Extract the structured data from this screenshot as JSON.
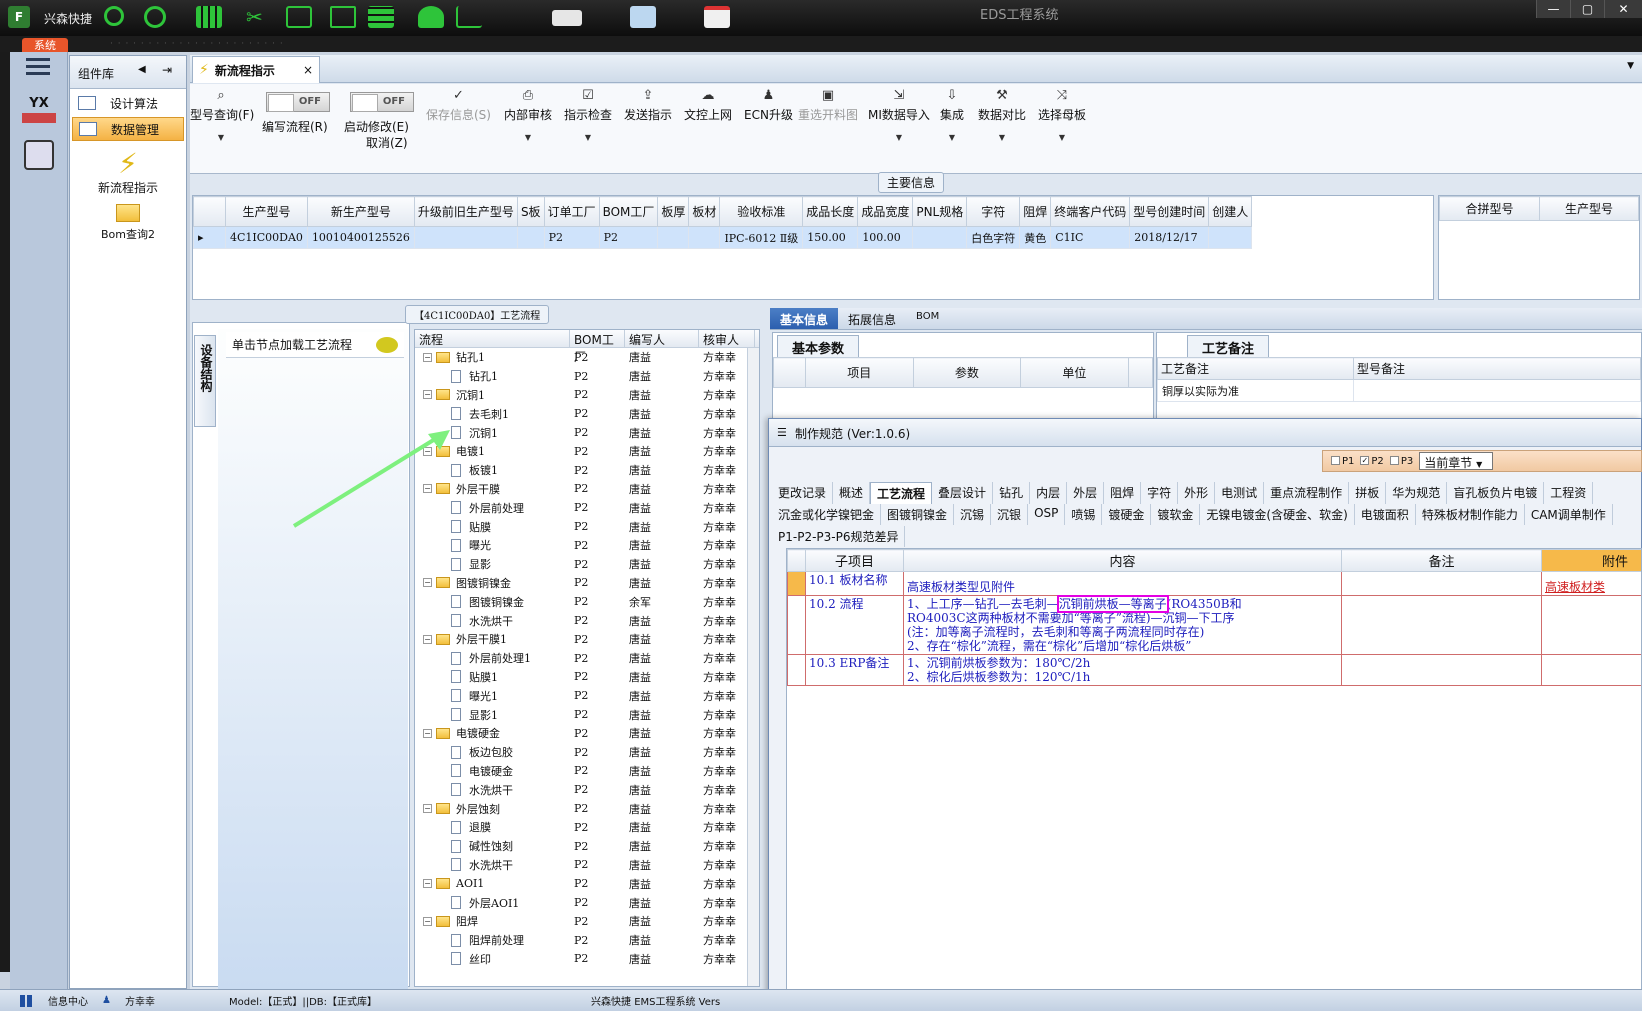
{
  "titlebar": {
    "app_name": "兴森快捷",
    "window_title": "EDS工程系统",
    "btn_min": "—",
    "btn_max": "▢",
    "btn_close": "✕"
  },
  "blurred": "· · · · · · · · · · · · · · · · · · · · · · ·",
  "system_tab": "系统",
  "nav": {
    "yx_label": "YX"
  },
  "component_panel": {
    "title": "组件库",
    "items": [
      {
        "label": "设计算法"
      },
      {
        "label": "数据管理"
      }
    ],
    "big_items": [
      {
        "label": "新流程指示"
      },
      {
        "label": "Bom查询2"
      }
    ]
  },
  "doc_tab": {
    "label": "新流程指示",
    "close": "×"
  },
  "ribbon": {
    "query": "型号查询(F)",
    "toggle_write": {
      "state": "OFF",
      "label": "编写流程(R)"
    },
    "toggle_modify": {
      "state": "OFF",
      "label": "启动修改(E)",
      "label2": "取消(Z)"
    },
    "save": "保存信息(S)",
    "internal_review": "内部审核",
    "check": "指示检查",
    "send": "发送指示",
    "upload": "文控上网",
    "ecn": "ECN升级",
    "reselect": "重选开料图",
    "mi_import": "MI数据导入",
    "integrate": "集成",
    "compare": "数据对比",
    "select_mother": "选择母板"
  },
  "main_info": {
    "title": "主要信息",
    "columns": [
      "生产型号",
      "新生产型号",
      "升级前旧生产型号",
      "S板",
      "订单工厂",
      "BOM工厂",
      "板厚",
      "板材",
      "验收标准",
      "成品长度",
      "成品宽度",
      "PNL规格",
      "字符",
      "阻焊",
      "终端客户代码",
      "型号创建时间",
      "创建人"
    ],
    "row": [
      "4C1IC00DA0",
      "10010400125526",
      "",
      "",
      "P2",
      "P2",
      "",
      "",
      "IPC-6012 Ⅱ级",
      "150.00",
      "100.00",
      "",
      "白色字符",
      "黄色",
      "C1IC",
      "2018/12/17",
      ""
    ],
    "merge_cols": [
      "合拼型号",
      "生产型号"
    ]
  },
  "left_panel": {
    "vtab": "设备结构",
    "message": "单击节点加载工艺流程"
  },
  "tree": {
    "title": "【4C1IC00DA0】工艺流程",
    "columns": [
      "流程",
      "BOM工厂",
      "编写人",
      "核审人"
    ],
    "rows": [
      {
        "name": "钻孔1",
        "folder": true,
        "factory": "P2",
        "writer": "唐益",
        "reviewer": "方幸幸"
      },
      {
        "name": "钻孔1",
        "folder": false,
        "factory": "P2",
        "writer": "唐益",
        "reviewer": "方幸幸"
      },
      {
        "name": "沉铜1",
        "folder": true,
        "factory": "P2",
        "writer": "唐益",
        "reviewer": "方幸幸"
      },
      {
        "name": "去毛刺1",
        "folder": false,
        "factory": "P2",
        "writer": "唐益",
        "reviewer": "方幸幸"
      },
      {
        "name": "沉铜1",
        "folder": false,
        "factory": "P2",
        "writer": "唐益",
        "reviewer": "方幸幸"
      },
      {
        "name": "电镀1",
        "folder": true,
        "factory": "P2",
        "writer": "唐益",
        "reviewer": "方幸幸"
      },
      {
        "name": "板镀1",
        "folder": false,
        "factory": "P2",
        "writer": "唐益",
        "reviewer": "方幸幸"
      },
      {
        "name": "外层干膜",
        "folder": true,
        "factory": "P2",
        "writer": "唐益",
        "reviewer": "方幸幸"
      },
      {
        "name": "外层前处理",
        "folder": false,
        "factory": "P2",
        "writer": "唐益",
        "reviewer": "方幸幸"
      },
      {
        "name": "贴膜",
        "folder": false,
        "factory": "P2",
        "writer": "唐益",
        "reviewer": "方幸幸"
      },
      {
        "name": "曝光",
        "folder": false,
        "factory": "P2",
        "writer": "唐益",
        "reviewer": "方幸幸"
      },
      {
        "name": "显影",
        "folder": false,
        "factory": "P2",
        "writer": "唐益",
        "reviewer": "方幸幸"
      },
      {
        "name": "图镀铜镍金",
        "folder": true,
        "factory": "P2",
        "writer": "唐益",
        "reviewer": "方幸幸"
      },
      {
        "name": "图镀铜镍金",
        "folder": false,
        "factory": "P2",
        "writer": "余军",
        "reviewer": "方幸幸"
      },
      {
        "name": "水洗烘干",
        "folder": false,
        "factory": "P2",
        "writer": "唐益",
        "reviewer": "方幸幸"
      },
      {
        "name": "外层干膜1",
        "folder": true,
        "factory": "P2",
        "writer": "唐益",
        "reviewer": "方幸幸"
      },
      {
        "name": "外层前处理1",
        "folder": false,
        "factory": "P2",
        "writer": "唐益",
        "reviewer": "方幸幸"
      },
      {
        "name": "贴膜1",
        "folder": false,
        "factory": "P2",
        "writer": "唐益",
        "reviewer": "方幸幸"
      },
      {
        "name": "曝光1",
        "folder": false,
        "factory": "P2",
        "writer": "唐益",
        "reviewer": "方幸幸"
      },
      {
        "name": "显影1",
        "folder": false,
        "factory": "P2",
        "writer": "唐益",
        "reviewer": "方幸幸"
      },
      {
        "name": "电镀硬金",
        "folder": true,
        "factory": "P2",
        "writer": "唐益",
        "reviewer": "方幸幸"
      },
      {
        "name": "板边包胶",
        "folder": false,
        "factory": "P2",
        "writer": "唐益",
        "reviewer": "方幸幸"
      },
      {
        "name": "电镀硬金",
        "folder": false,
        "factory": "P2",
        "writer": "唐益",
        "reviewer": "方幸幸"
      },
      {
        "name": "水洗烘干",
        "folder": false,
        "factory": "P2",
        "writer": "唐益",
        "reviewer": "方幸幸"
      },
      {
        "name": "外层蚀刻",
        "folder": true,
        "factory": "P2",
        "writer": "唐益",
        "reviewer": "方幸幸"
      },
      {
        "name": "退膜",
        "folder": false,
        "factory": "P2",
        "writer": "唐益",
        "reviewer": "方幸幸"
      },
      {
        "name": "碱性蚀刻",
        "folder": false,
        "factory": "P2",
        "writer": "唐益",
        "reviewer": "方幸幸"
      },
      {
        "name": "水洗烘干",
        "folder": false,
        "factory": "P2",
        "writer": "唐益",
        "reviewer": "方幸幸"
      },
      {
        "name": "AOI1",
        "folder": true,
        "factory": "P2",
        "writer": "唐益",
        "reviewer": "方幸幸"
      },
      {
        "name": "外层AOI1",
        "folder": false,
        "factory": "P2",
        "writer": "唐益",
        "reviewer": "方幸幸"
      },
      {
        "name": "阻焊",
        "folder": true,
        "factory": "P2",
        "writer": "唐益",
        "reviewer": "方幸幸"
      },
      {
        "name": "阻焊前处理",
        "folder": false,
        "factory": "P2",
        "writer": "唐益",
        "reviewer": "方幸幸"
      },
      {
        "name": "丝印",
        "folder": false,
        "factory": "P2",
        "writer": "唐益",
        "reviewer": "方幸幸"
      }
    ]
  },
  "right_tabs": [
    "基本信息",
    "拓展信息",
    "BOM"
  ],
  "basic_params": {
    "tab": "基本参数",
    "cols": [
      "项目",
      "参数",
      "单位"
    ]
  },
  "craft_notes": {
    "tab": "工艺备注",
    "cols": [
      "工艺备注",
      "型号备注"
    ],
    "value": "铜厚以实际为准"
  },
  "dialog": {
    "title": "制作规范 (Ver:1.0.6)",
    "checks": [
      {
        "label": "P1",
        "checked": false
      },
      {
        "label": "P2",
        "checked": true
      },
      {
        "label": "P3",
        "checked": false
      }
    ],
    "chapter": "当前章节",
    "tabs_row1": [
      "更改记录",
      "概述",
      "工艺流程",
      "叠层设计",
      "钻孔",
      "内层",
      "外层",
      "阻焊",
      "字符",
      "外形",
      "电测试",
      "重点流程制作",
      "拼板",
      "华为规范",
      "盲孔板负片电镀",
      "工程资"
    ],
    "tabs_row2": [
      "沉金或化学镍钯金",
      "图镀铜镍金",
      "沉锡",
      "沉银",
      "OSP",
      "喷锡",
      "镀硬金",
      "镀软金",
      "无镍电镀金(含硬金、软金)",
      "电镀面积",
      "特殊板材制作能力",
      "CAM调单制作"
    ],
    "tabs_row3": [
      "P1-P2-P3-P6规范差异"
    ],
    "spec_cols": [
      "子项目",
      "内容",
      "备注",
      "附件"
    ],
    "spec_rows": [
      {
        "item": "10.1 板材名称",
        "content_lines": [
          "高速板材类型见附件"
        ],
        "note": "",
        "attach": "高速板材类"
      },
      {
        "item": "10.2 流程",
        "content_lines": [
          "1、上工序—钻孔—去毛刺—",
          "沉铜前烘板—等离子",
          "(RO4350B和",
          "RO4003C这两种板材不需要加“等离子”流程)—沉铜—下工序",
          "(注：加等离子流程时，去毛刺和等离子两流程同时存在)",
          "2、存在“棕化”流程，需在“棕化”后增加“棕化后烘板”"
        ],
        "note": "",
        "attach": ""
      },
      {
        "item": "10.3 ERP备注",
        "content_lines": [
          "1、沉铜前烘板参数为：180℃/2h",
          "2、棕化后烘板参数为：120℃/1h"
        ],
        "note": "",
        "attach": ""
      }
    ]
  },
  "statusbar": {
    "info_center": "信息中心",
    "user": "方幸幸",
    "model": "Model:【正式】||DB:【正式库】",
    "system": "兴森快捷 EMS工程系统 Vers"
  },
  "colors": {
    "highlight": "#e400e4",
    "arrow": "#7ef07e",
    "selected_nav": "#f4b244"
  }
}
